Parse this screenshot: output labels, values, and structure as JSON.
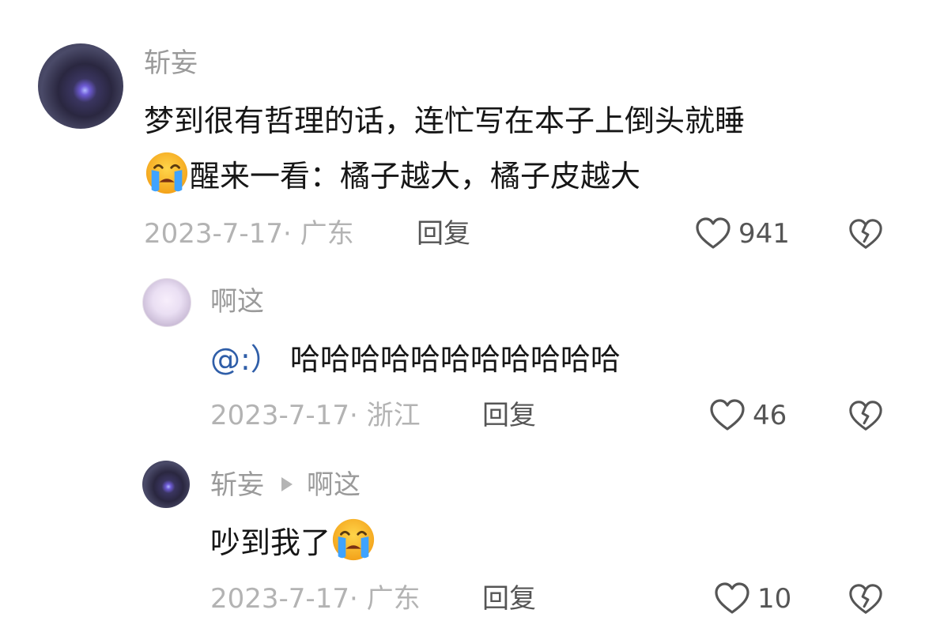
{
  "comments": [
    {
      "username": "斩妄",
      "text_line1": "梦到很有哲理的话，连忙写在本子上倒头就睡",
      "emoji": "crying-face-icon",
      "text_line2": "醒来一看：橘子越大，橘子皮越大",
      "date_loc": "2023-7-17· 广东",
      "reply_label": "回复",
      "likes": "941"
    },
    {
      "username": "啊这",
      "mention": "@:）",
      "text": "哈哈哈哈哈哈哈哈哈哈哈",
      "date_loc": "2023-7-17· 浙江",
      "reply_label": "回复",
      "likes": "46"
    },
    {
      "username": "斩妄",
      "reply_to": "啊这",
      "text": "吵到我了",
      "emoji": "crying-face-icon",
      "date_loc": "2023-7-17· 广东",
      "reply_label": "回复",
      "likes": "10"
    }
  ]
}
